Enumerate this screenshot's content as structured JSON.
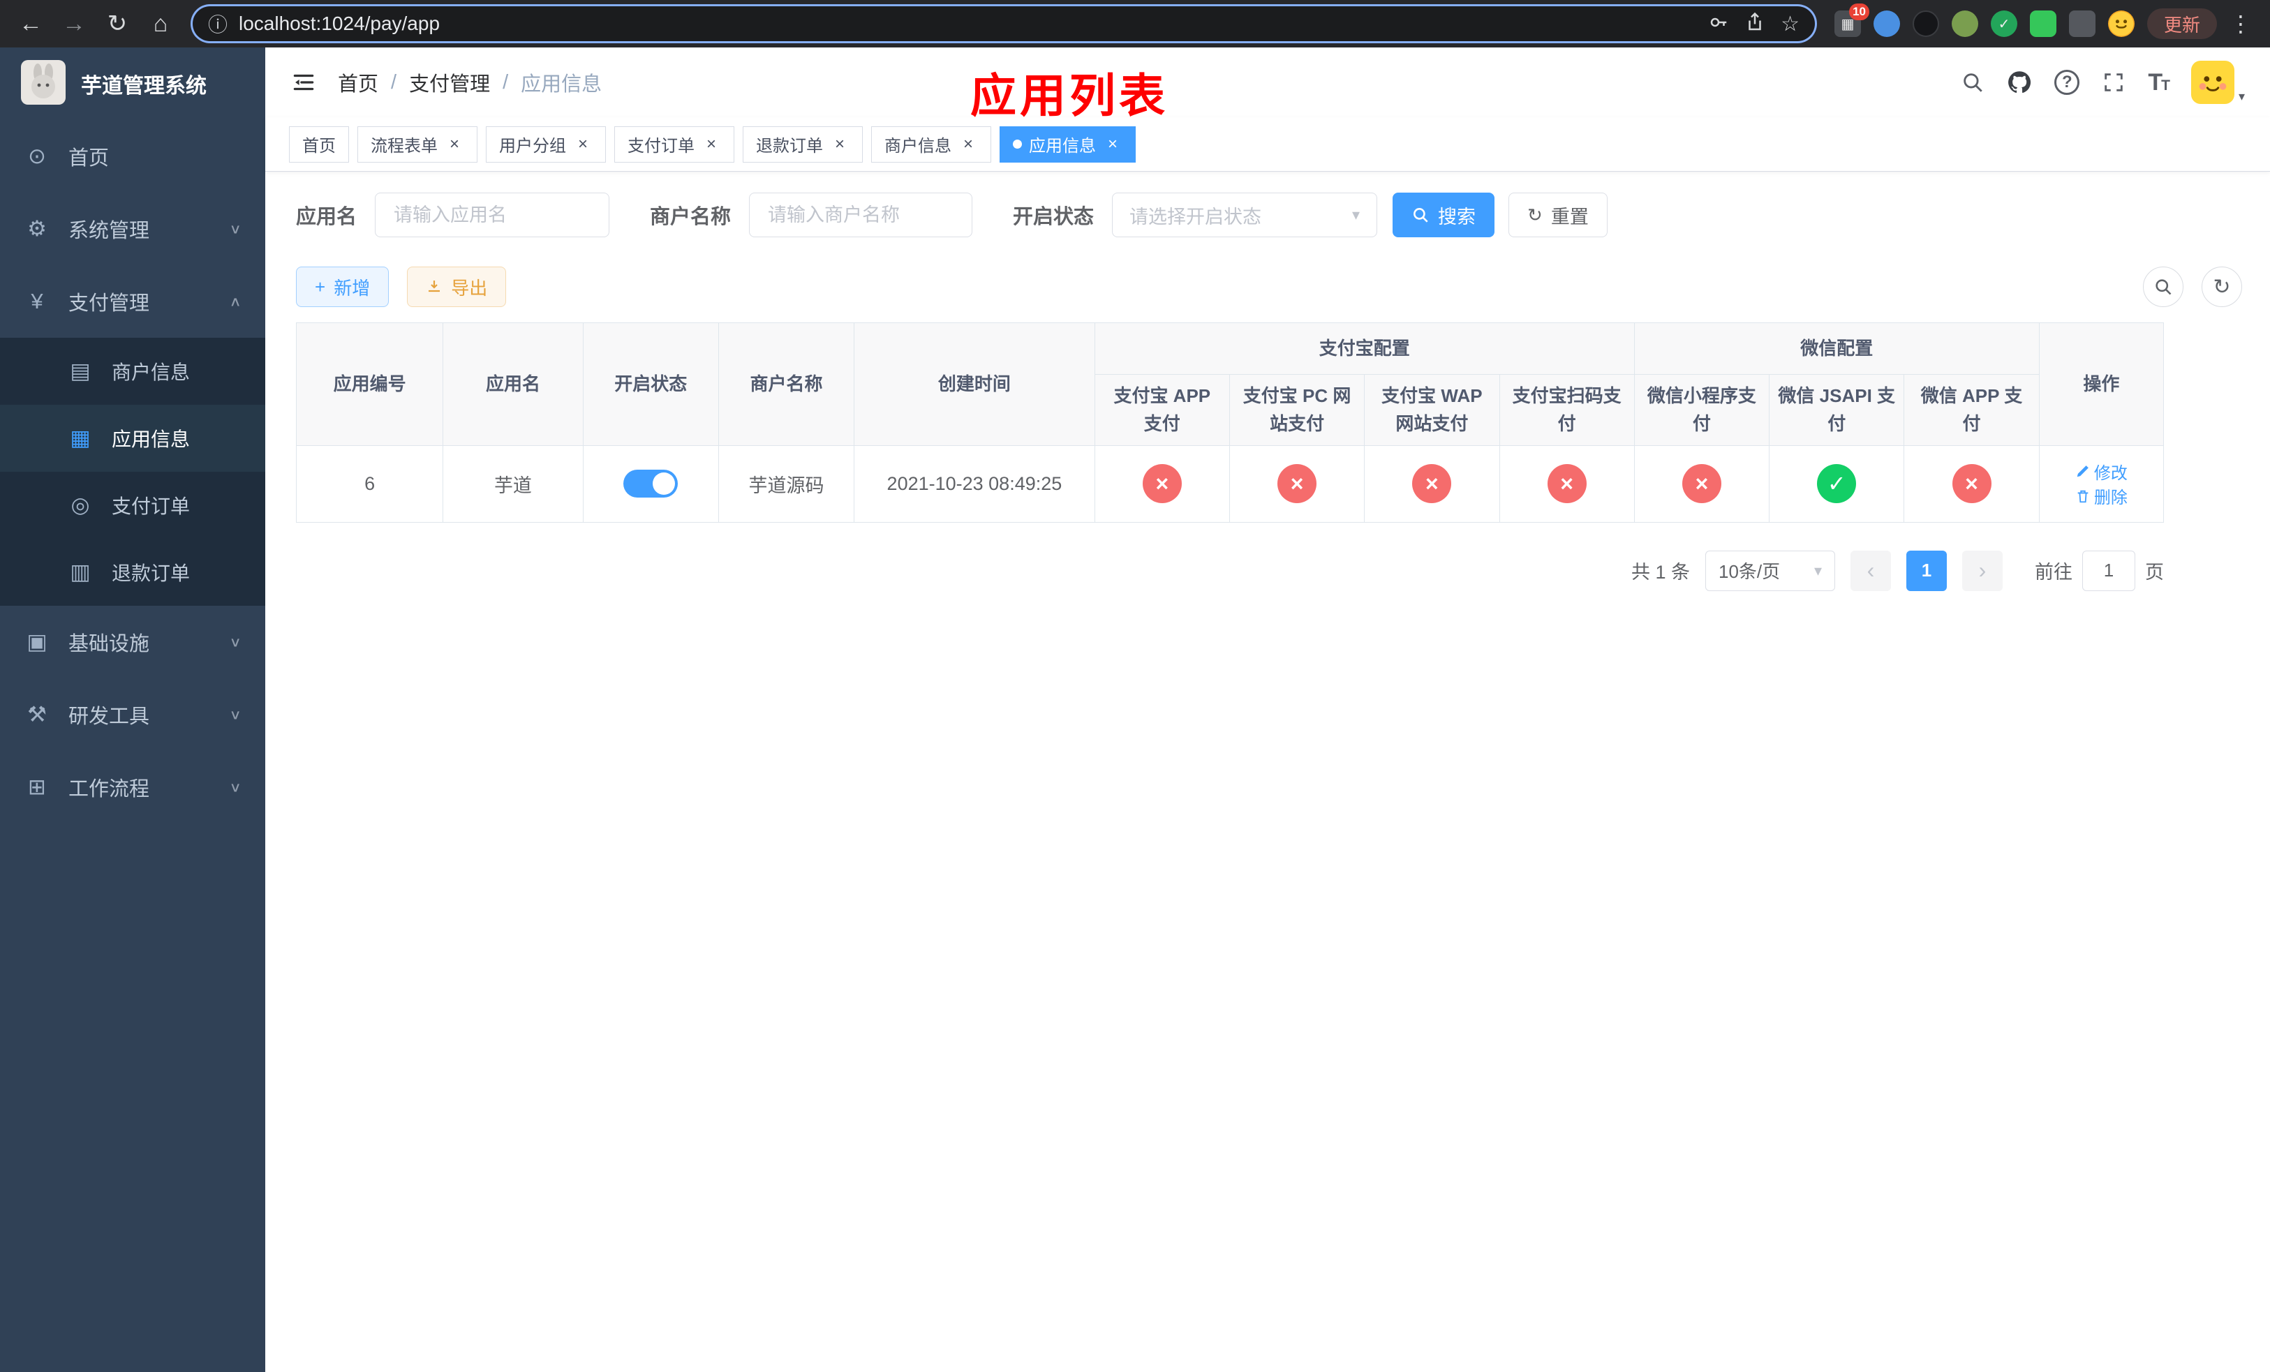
{
  "browser": {
    "url": "localhost:1024/pay/app",
    "update_label": "更新",
    "extensions_badge": "10"
  },
  "icons": {
    "back": "←",
    "forward": "→",
    "reload": "↻",
    "home": "⌂",
    "info": "ⓘ",
    "star": "☆",
    "dots": "⋮",
    "caret": "▾",
    "chevron_down": "∨",
    "chevron_up": "∧",
    "dashboard": "⊙",
    "gear": "⚙",
    "yen": "¥",
    "card": "▤",
    "grid": "▦",
    "order": "◎",
    "refund": "▥",
    "infra": "▣",
    "tools": "⚒",
    "workflow": "⊞",
    "plus": "+",
    "check": "✓",
    "cross": "×",
    "close": "×",
    "prev": "‹",
    "next": "›",
    "refresh": "↻"
  },
  "sidebar": {
    "title": "芋道管理系统",
    "items": [
      {
        "label": "首页"
      },
      {
        "label": "系统管理"
      },
      {
        "label": "支付管理",
        "children": [
          {
            "label": "商户信息"
          },
          {
            "label": "应用信息"
          },
          {
            "label": "支付订单"
          },
          {
            "label": "退款订单"
          }
        ]
      },
      {
        "label": "基础设施"
      },
      {
        "label": "研发工具"
      },
      {
        "label": "工作流程"
      }
    ]
  },
  "header": {
    "breadcrumb": [
      "首页",
      "支付管理",
      "应用信息"
    ],
    "overlay_title": "应用列表"
  },
  "tabs": [
    {
      "label": "首页"
    },
    {
      "label": "流程表单"
    },
    {
      "label": "用户分组"
    },
    {
      "label": "支付订单"
    },
    {
      "label": "退款订单"
    },
    {
      "label": "商户信息"
    },
    {
      "label": "应用信息"
    }
  ],
  "filters": {
    "app_name_label": "应用名",
    "app_name_placeholder": "请输入应用名",
    "merchant_label": "商户名称",
    "merchant_placeholder": "请输入商户名称",
    "status_label": "开启状态",
    "status_placeholder": "请选择开启状态",
    "search_label": "搜索",
    "reset_label": "重置"
  },
  "toolbar": {
    "add_label": "新增",
    "export_label": "导出"
  },
  "table": {
    "groups": {
      "alipay": "支付宝配置",
      "wechat": "微信配置"
    },
    "columns": {
      "id": "应用编号",
      "name": "应用名",
      "status": "开启状态",
      "merchant": "商户名称",
      "created": "创建时间",
      "alipay_app": "支付宝 APP 支付",
      "alipay_pc": "支付宝 PC 网站支付",
      "alipay_wap": "支付宝 WAP 网站支付",
      "alipay_qr": "支付宝扫码支付",
      "wx_mini": "微信小程序支付",
      "wx_jsapi": "微信 JSAPI 支付",
      "wx_app": "微信 APP 支付",
      "ops": "操作"
    },
    "row": {
      "id": "6",
      "name": "芋道",
      "enabled": true,
      "merchant": "芋道源码",
      "created": "2021-10-23 08:49:25",
      "statuses": [
        "fail",
        "fail",
        "fail",
        "fail",
        "fail",
        "ok",
        "fail"
      ],
      "edit_label": "修改",
      "delete_label": "删除"
    }
  },
  "pagination": {
    "total_text": "共 1 条",
    "page_size": "10条/页",
    "current_page": "1",
    "goto_prefix": "前往",
    "goto_value": "1",
    "goto_suffix": "页"
  },
  "colors": {
    "primary": "#409eff",
    "danger": "#f56c6c",
    "success": "#13ce66",
    "sidebar_bg": "#304156",
    "submenu_bg": "#1f2d3d",
    "overlay_red": "#fe0000"
  }
}
